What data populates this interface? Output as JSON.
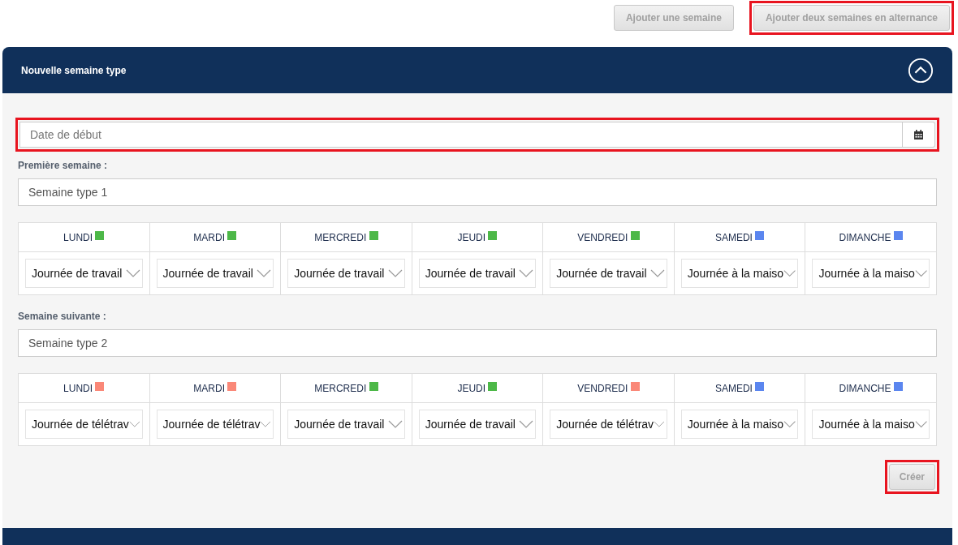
{
  "top_buttons": [
    {
      "label": "Ajouter une semaine",
      "disabled": true,
      "highlighted": false
    },
    {
      "label": "Ajouter deux semaines en alternance",
      "disabled": true,
      "highlighted": true
    }
  ],
  "panel": {
    "title": "Nouvelle semaine type",
    "expanded": true
  },
  "start_date": {
    "placeholder": "Date de début",
    "highlighted": true
  },
  "weeks": [
    {
      "label": "Première semaine :",
      "value": "Semaine type 1",
      "days": [
        {
          "name": "LUNDI",
          "color": "#4db848",
          "value": "Journée de travail"
        },
        {
          "name": "MARDI",
          "color": "#4db848",
          "value": "Journée de travail"
        },
        {
          "name": "MERCREDI",
          "color": "#4db848",
          "value": "Journée de travail"
        },
        {
          "name": "JEUDI",
          "color": "#4db848",
          "value": "Journée de travail"
        },
        {
          "name": "VENDREDI",
          "color": "#4db848",
          "value": "Journée de travail"
        },
        {
          "name": "SAMEDI",
          "color": "#5b86ef",
          "value": "Journée à la maiso"
        },
        {
          "name": "DIMANCHE",
          "color": "#5b86ef",
          "value": "Journée à la maiso"
        }
      ]
    },
    {
      "label": "Semaine suivante :",
      "value": "Semaine type 2",
      "days": [
        {
          "name": "LUNDI",
          "color": "#fa8878",
          "value": "Journée de télétrav"
        },
        {
          "name": "MARDI",
          "color": "#fa8878",
          "value": "Journée de télétrav"
        },
        {
          "name": "MERCREDI",
          "color": "#4db848",
          "value": "Journée de travail"
        },
        {
          "name": "JEUDI",
          "color": "#4db848",
          "value": "Journée de travail"
        },
        {
          "name": "VENDREDI",
          "color": "#fa8878",
          "value": "Journée de télétrav"
        },
        {
          "name": "SAMEDI",
          "color": "#5b86ef",
          "value": "Journée à la maiso"
        },
        {
          "name": "DIMANCHE",
          "color": "#5b86ef",
          "value": "Journée à la maiso"
        }
      ]
    }
  ],
  "submit": {
    "label": "Créer",
    "disabled": true,
    "highlighted": true
  }
}
